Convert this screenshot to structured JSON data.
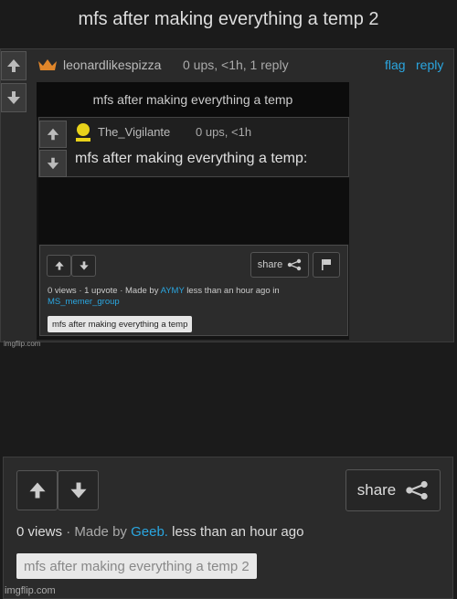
{
  "page": {
    "title": "mfs after making everything a temp 2"
  },
  "comment": {
    "username": "leonardlikespizza",
    "meta": "0 ups, <1h, 1 reply",
    "flag_label": "flag",
    "reply_label": "reply",
    "image": {
      "title_bar": "mfs after making everything a temp",
      "nested_comment": {
        "username": "The_Vigilante",
        "meta": "0 ups, <1h",
        "text": "mfs after making everything a temp:"
      },
      "post": {
        "share_label": "share",
        "info_line1_prefix": "0 views · 1 upvote · Made by ",
        "author": "AYMY",
        "info_line1_suffix": " less than an hour ago in",
        "stream": "MS_memer_group",
        "tag": "mfs after making everything a temp"
      },
      "watermark": "imgflip.com"
    }
  },
  "post": {
    "share_label": "share",
    "views": "0 views",
    "made_by": "Made by",
    "author": "Geeb.",
    "time": "less than an hour ago",
    "tag": "mfs after making everything a temp 2",
    "watermark": "imgflip.com"
  },
  "colors": {
    "link": "#2aa6e0",
    "crown": "#e0862a",
    "avatar_yellow": "#e8d21a"
  }
}
